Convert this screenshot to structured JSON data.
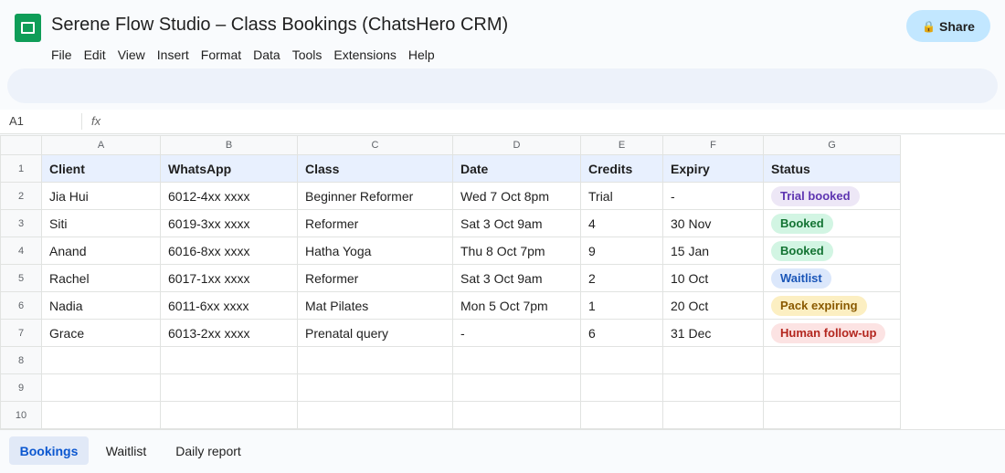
{
  "app": {
    "title": "Serene Flow Studio – Class Bookings (ChatsHero CRM)",
    "share_label": "Share",
    "share_icon": "lock-icon",
    "brand_color": "#0f9d58",
    "accent_color": "#0b57d0"
  },
  "menu": [
    "File",
    "Edit",
    "View",
    "Insert",
    "Format",
    "Data",
    "Tools",
    "Extensions",
    "Help"
  ],
  "formula_bar": {
    "cell_ref": "A1",
    "fx_label": "fx",
    "value": ""
  },
  "grid": {
    "columns": [
      "A",
      "B",
      "C",
      "D",
      "E",
      "F",
      "G"
    ],
    "row_numbers": [
      "1",
      "2",
      "3",
      "4",
      "5",
      "6",
      "7",
      "8",
      "9",
      "10"
    ],
    "header": [
      "Client",
      "WhatsApp",
      "Class",
      "Date",
      "Credits",
      "Expiry",
      "Status"
    ],
    "rows": [
      {
        "client": "Jia Hui",
        "whatsapp": "6012-4xx xxxx",
        "class": "Beginner Reformer",
        "date": "Wed 7 Oct 8pm",
        "credits": "Trial",
        "expiry": "-",
        "status": "Trial booked",
        "status_kind": "trial"
      },
      {
        "client": "Siti",
        "whatsapp": "6019-3xx xxxx",
        "class": "Reformer",
        "date": "Sat 3 Oct 9am",
        "credits": "4",
        "expiry": "30 Nov",
        "status": "Booked",
        "status_kind": "booked"
      },
      {
        "client": "Anand",
        "whatsapp": "6016-8xx xxxx",
        "class": "Hatha Yoga",
        "date": "Thu 8 Oct 7pm",
        "credits": "9",
        "expiry": "15 Jan",
        "status": "Booked",
        "status_kind": "booked"
      },
      {
        "client": "Rachel",
        "whatsapp": "6017-1xx xxxx",
        "class": "Reformer",
        "date": "Sat 3 Oct 9am",
        "credits": "2",
        "expiry": "10 Oct",
        "status": "Waitlist",
        "status_kind": "waitlist"
      },
      {
        "client": "Nadia",
        "whatsapp": "6011-6xx xxxx",
        "class": "Mat Pilates",
        "date": "Mon 5 Oct 7pm",
        "credits": "1",
        "expiry": "20 Oct",
        "status": "Pack expiring",
        "status_kind": "expiring"
      },
      {
        "client": "Grace",
        "whatsapp": "6013-2xx xxxx",
        "class": "Prenatal query",
        "date": "-",
        "credits": "6",
        "expiry": "31 Dec",
        "status": "Human follow-up",
        "status_kind": "human"
      }
    ]
  },
  "sheet_tabs": [
    {
      "label": "Bookings",
      "active": true
    },
    {
      "label": "Waitlist",
      "active": false
    },
    {
      "label": "Daily report",
      "active": false
    }
  ]
}
